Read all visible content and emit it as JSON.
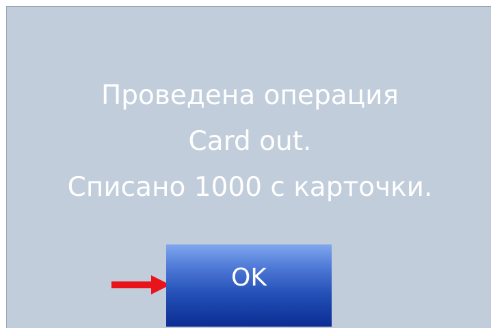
{
  "dialog": {
    "message_lines": [
      "Проведена операция",
      "Card out.",
      "Списано 1000 с карточки."
    ],
    "ok_label": "OK"
  },
  "colors": {
    "dialog_background": "#c1cddb",
    "message_text": "#ffffff",
    "button_top": "#7fa7ee",
    "button_bottom": "#0b2d93",
    "arrow": "#e8131b"
  },
  "icons": {
    "pointer": "red-arrow-icon"
  }
}
